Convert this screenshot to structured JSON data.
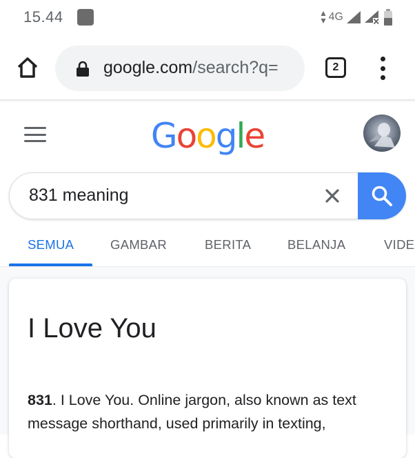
{
  "status_bar": {
    "time": "15.44",
    "network": "4G",
    "icons": [
      "notification-icon",
      "data-arrows-icon",
      "signal-icon",
      "signal-no-data-icon",
      "battery-icon"
    ]
  },
  "browser": {
    "url_domain": "google.com",
    "url_path": "/search?q=",
    "tab_count": "2",
    "icons": [
      "home-icon",
      "lock-icon",
      "tabs-icon",
      "more-vert-icon"
    ]
  },
  "google": {
    "logo_letters": [
      "G",
      "o",
      "o",
      "g",
      "l",
      "e"
    ],
    "logo_colors": [
      "#4285F4",
      "#EA4335",
      "#FBBC05",
      "#4285F4",
      "#34A853",
      "#EA4335"
    ]
  },
  "search": {
    "query": "831 meaning",
    "accent_color": "#4285F4"
  },
  "tabs": [
    {
      "label": "SEMUA",
      "active": true
    },
    {
      "label": "GAMBAR",
      "active": false
    },
    {
      "label": "BERITA",
      "active": false
    },
    {
      "label": "BELANJA",
      "active": false
    },
    {
      "label": "VIDE",
      "active": false
    }
  ],
  "result": {
    "answer": "I Love You",
    "snippet_bold": "831",
    "snippet_line1_rest": ". I Love You. Online jargon, also known as text",
    "snippet_line2": "message shorthand, used primarily in texting,"
  }
}
